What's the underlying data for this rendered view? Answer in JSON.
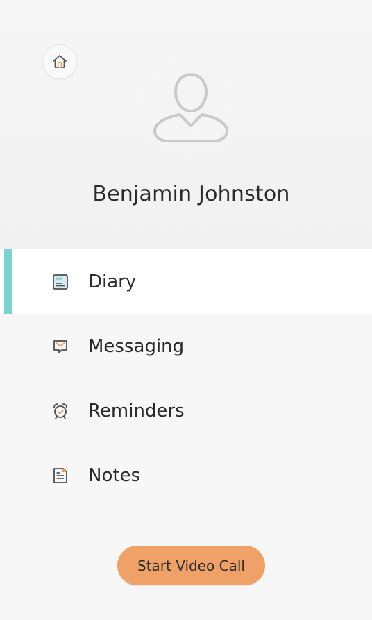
{
  "profile": {
    "name": "Benjamin Johnston",
    "home_icon": "home-icon",
    "avatar_icon": "user-avatar-icon"
  },
  "nav": {
    "items": [
      {
        "label": "Diary",
        "icon": "diary-icon",
        "active": true
      },
      {
        "label": "Messaging",
        "icon": "messaging-icon",
        "active": false
      },
      {
        "label": "Reminders",
        "icon": "alarm-clock-icon",
        "active": false
      },
      {
        "label": "Notes",
        "icon": "notes-icon",
        "active": false
      }
    ]
  },
  "actions": {
    "video_call_label": "Start Video Call"
  },
  "colors": {
    "active_indicator": "#7ad3cf",
    "accent_orange": "#efa167",
    "icon_gray": "#5f5f5f"
  }
}
